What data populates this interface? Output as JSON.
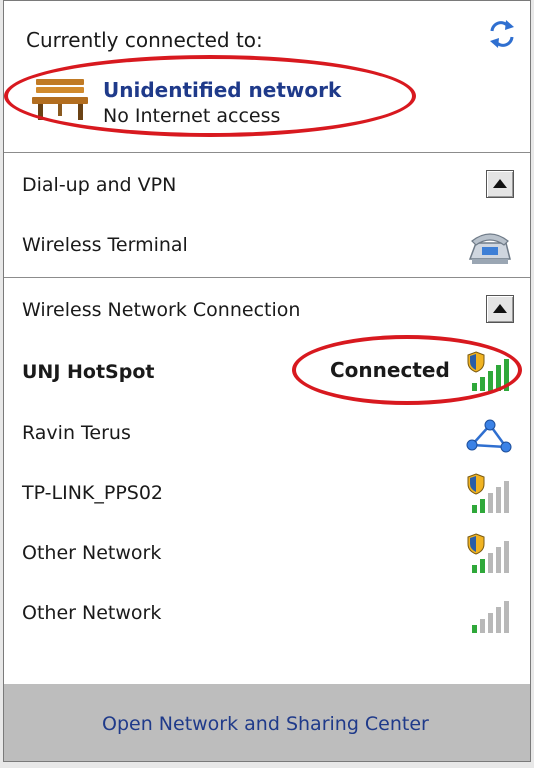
{
  "current": {
    "header": "Currently connected to:",
    "network_name": "Unidentified network",
    "network_status": "No Internet access"
  },
  "dialup": {
    "section_label": "Dial-up and VPN",
    "items": [
      {
        "label": "Wireless Terminal"
      }
    ]
  },
  "wireless": {
    "section_label": "Wireless Network Connection",
    "networks": [
      {
        "name": "UNJ HotSpot",
        "status": "Connected",
        "signal_bars": 5,
        "secured": true
      },
      {
        "name": "Ravin Terus",
        "status": "",
        "signal_bars": 0,
        "secured": false,
        "icon": "adhoc-network-icon"
      },
      {
        "name": "TP-LINK_PPS02",
        "status": "",
        "signal_bars": 2,
        "secured": true
      },
      {
        "name": "Other Network",
        "status": "",
        "signal_bars": 2,
        "secured": true
      },
      {
        "name": "Other Network",
        "status": "",
        "signal_bars": 1,
        "secured": false
      }
    ]
  },
  "footer": {
    "link_label": "Open Network and Sharing Center"
  },
  "colors": {
    "accent_text": "#1f3a8a",
    "highlight_oval": "#d8191f",
    "signal_green": "#2fa83a",
    "signal_gray": "#b8b8b8"
  }
}
